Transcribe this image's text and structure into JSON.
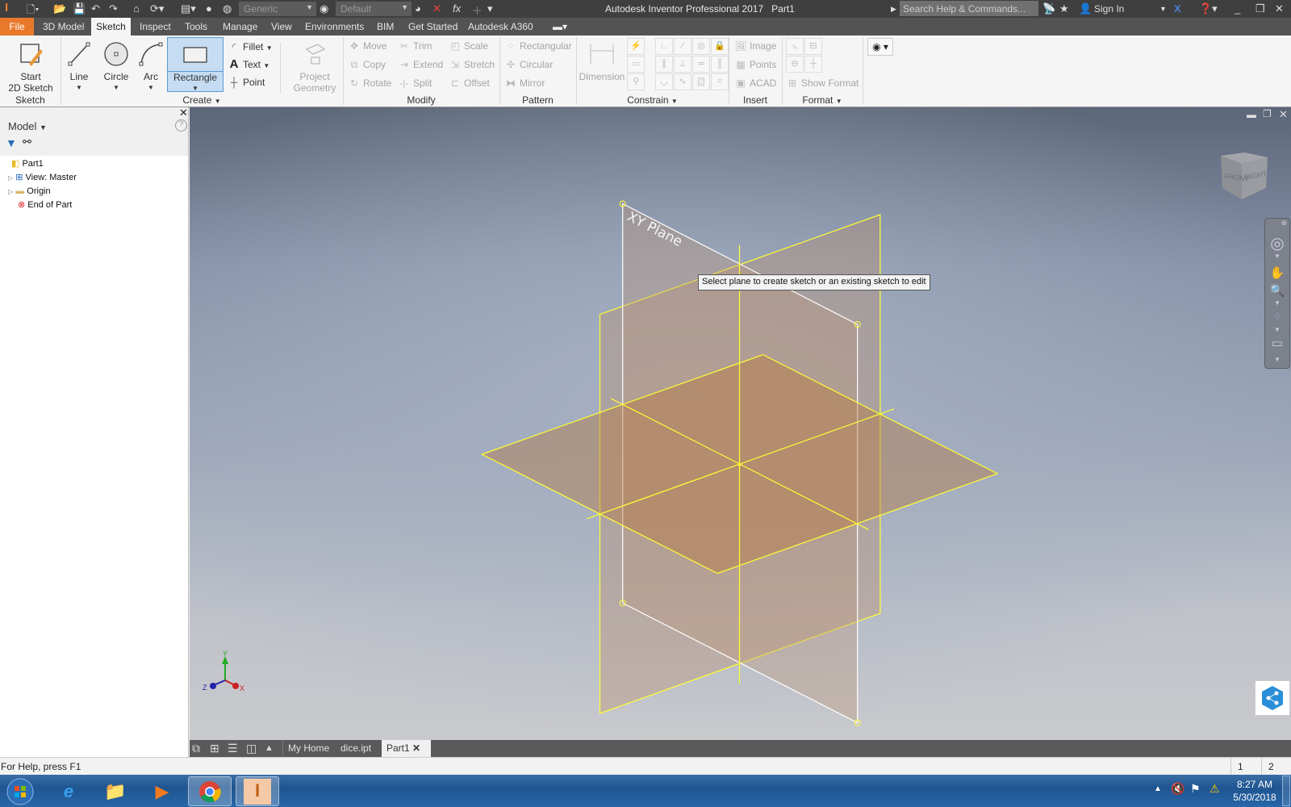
{
  "titlebar": {
    "app_title": "Autodesk Inventor Professional 2017",
    "doc_title": "Part1",
    "appearance_combo": "Generic",
    "material_combo": "Default",
    "search_placeholder": "Search Help & Commands...",
    "sign_in": "Sign In"
  },
  "menu_tabs": [
    "File",
    "3D Model",
    "Sketch",
    "Inspect",
    "Tools",
    "Manage",
    "View",
    "Environments",
    "BIM",
    "Get Started",
    "Autodesk A360"
  ],
  "active_tab": "Sketch",
  "ribbon": {
    "sketch_panel": {
      "label": "Sketch",
      "start_sketch": "Start\n2D Sketch"
    },
    "create_panel": {
      "label": "Create",
      "line": "Line",
      "circle": "Circle",
      "arc": "Arc",
      "rectangle": "Rectangle",
      "fillet": "Fillet",
      "text": "Text",
      "point": "Point",
      "project_geometry_1": "Project",
      "project_geometry_2": "Geometry"
    },
    "modify_panel": {
      "label": "Modify",
      "items": [
        "Move",
        "Trim",
        "Scale",
        "Copy",
        "Extend",
        "Stretch",
        "Rotate",
        "Split",
        "Offset"
      ]
    },
    "pattern_panel": {
      "label": "Pattern",
      "items": [
        "Rectangular",
        "Circular",
        "Mirror"
      ]
    },
    "constrain_panel": {
      "label": "Constrain",
      "dimension": "Dimension",
      "icons": [
        "coincident",
        "collinear",
        "concentric",
        "fix",
        "parallel",
        "perpendicular",
        "horizontal",
        "vertical",
        "tangent",
        "smooth",
        "symmetric",
        "equal"
      ]
    },
    "insert_panel": {
      "label": "Insert",
      "items": [
        "Image",
        "Points",
        "ACAD"
      ]
    },
    "format_panel": {
      "label": "Format",
      "show_format": "Show Format"
    }
  },
  "browser": {
    "title": "Model",
    "tree": [
      {
        "label": "Part1",
        "icon": "part-icon"
      },
      {
        "label": "View: Master",
        "icon": "view-icon",
        "expandable": true
      },
      {
        "label": "Origin",
        "icon": "folder-icon",
        "expandable": true
      },
      {
        "label": "End of Part",
        "icon": "end-of-part-icon"
      }
    ]
  },
  "viewport": {
    "plane_label": "XY Plane",
    "tooltip": "Select plane to create sketch or an existing sketch to edit",
    "viewcube": {
      "front": "FRONT",
      "right": "RIGHT"
    },
    "triad": {
      "x": "X",
      "y": "Y",
      "z": "Z"
    },
    "colors": {
      "work_plane_edge": "#ffff33",
      "selected_plane_edge": "#ffffff",
      "plane_fill": "#b4804a"
    }
  },
  "doc_tabs": [
    "My Home",
    "dice.ipt",
    "Part1"
  ],
  "active_doc": "Part1",
  "status": {
    "help": "For Help, press F1",
    "count1": "1",
    "count2": "2"
  },
  "taskbar": {
    "time": "8:27 AM",
    "date": "5/30/2018"
  }
}
